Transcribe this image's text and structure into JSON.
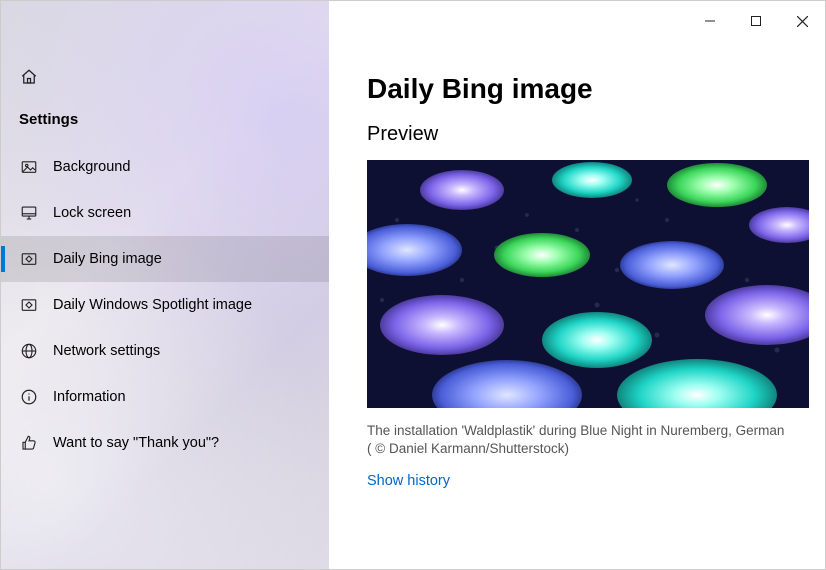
{
  "sidebar": {
    "heading": "Settings",
    "items": [
      {
        "label": "Background",
        "active": false
      },
      {
        "label": "Lock screen",
        "active": false
      },
      {
        "label": "Daily Bing image",
        "active": true
      },
      {
        "label": "Daily Windows Spotlight image",
        "active": false
      },
      {
        "label": "Network settings",
        "active": false
      },
      {
        "label": "Information",
        "active": false
      },
      {
        "label": "Want to say \"Thank you\"?",
        "active": false
      }
    ]
  },
  "content": {
    "page_title": "Daily Bing image",
    "section_title": "Preview",
    "caption": "The installation 'Waldplastik' during Blue Night in Nuremberg, German ( © Daniel Karmann/Shutterstock)",
    "show_history": "Show history"
  }
}
